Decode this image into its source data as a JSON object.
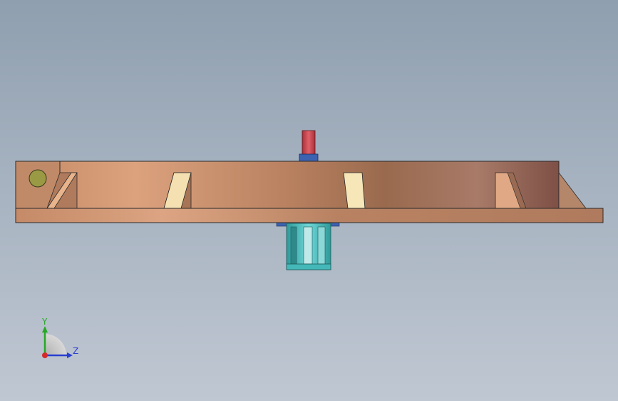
{
  "viewport": {
    "background_top": "#8f9faf",
    "background_bottom": "#bfc7d2"
  },
  "model": {
    "colors": {
      "frame_copper": "#c8906c",
      "frame_dark": "#8a5a48",
      "frame_light": "#dca27e",
      "base_plate": "#c58a68",
      "gusset_cream": "#f4e0b0",
      "gusset_peach": "#e8b48c",
      "hole_olive": "#9a9a45",
      "top_pin_red": "#c8484e",
      "top_collar_blue": "#3c62b0",
      "bottom_cage_cyan": "#44b8b8",
      "outline": "#2a2a2a"
    }
  },
  "triad": {
    "y_label": "Y",
    "z_label": "Z",
    "y_color": "#26a826",
    "z_color": "#2a3fcf",
    "x_color": "#d42a2a"
  }
}
